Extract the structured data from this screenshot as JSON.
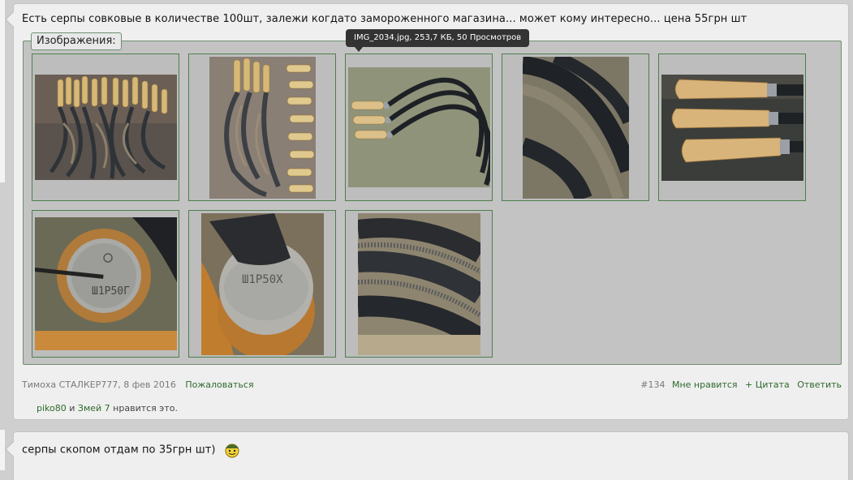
{
  "post1": {
    "text": "Есть серпы совковые в количестве 100шт, залежи когдато замороженного магазина... может кому интересно... цена 55грн шт",
    "attachments_label": "Изображения:",
    "tooltip": "IMG_2034.jpg, 253,7 КБ, 50 Просмотров",
    "thumbnails": [
      {
        "icon": "sickle-pile-photo-1"
      },
      {
        "icon": "sickle-pile-photo-2"
      },
      {
        "icon": "three-sickles-photo"
      },
      {
        "icon": "blade-closeup-photo"
      },
      {
        "icon": "wooden-handles-photo"
      },
      {
        "icon": "handle-stamp-photo-1"
      },
      {
        "icon": "handle-stamp-photo-2"
      },
      {
        "icon": "serrated-blade-photo"
      }
    ],
    "author": "Тимоха СТАЛКЕР777",
    "date": ", 8 фев 2016",
    "report": "Пожаловаться",
    "post_number": "#134",
    "like": "Мне нравится",
    "quote": "+ Цитата",
    "reply": "Ответить",
    "likers": {
      "user1": "piko80",
      "and": " и ",
      "user2": "Змей 7",
      "suffix": " нравится это."
    }
  },
  "post2": {
    "text": "серпы скопом отдам по 35грн шт)",
    "smiley_icon": "smiley-soldier-icon"
  },
  "colors": {
    "link": "#2d6a2d",
    "attachment_border": "#4d7f4d",
    "tooltip_bg": "#333333"
  }
}
